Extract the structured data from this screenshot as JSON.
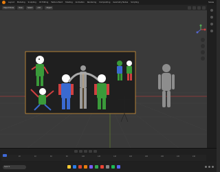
{
  "app": {
    "menu": [
      "",
      "Layout",
      "Modeling",
      "Sculpting",
      "UV Editing",
      "Texture Paint",
      "Shading",
      "Animation",
      "Rendering",
      "Compositing",
      "Geometry Nodes",
      "Scripting"
    ],
    "scene_label": "Scene"
  },
  "viewport_header": {
    "mode": "Object Mode",
    "view": "View",
    "select": "Select",
    "add": "Add",
    "object": "Object"
  },
  "timeline": {
    "ticks": [
      "0",
      "20",
      "40",
      "60",
      "80",
      "100",
      "120",
      "140",
      "160",
      "180",
      "200",
      "220",
      "240"
    ]
  },
  "taskbar": {
    "search_placeholder": "Search"
  },
  "colors": {
    "accent": "#e87d0d",
    "selection": "#e8a33a",
    "axis_red": "#a33b3b",
    "axis_green": "#6a8b2a"
  }
}
